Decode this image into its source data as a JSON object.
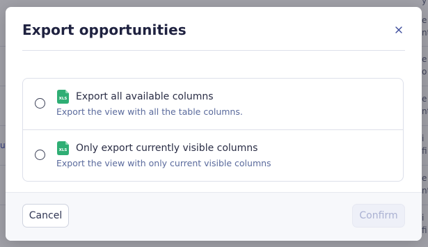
{
  "background": {
    "fragments": [
      {
        "text": "y",
        "accent": false
      },
      {
        "text": "e",
        "accent": false
      },
      {
        "text": "nt",
        "accent": false
      },
      {
        "text": "e",
        "accent": false
      },
      {
        "text": "o",
        "accent": false
      },
      {
        "text": "e",
        "accent": false
      },
      {
        "text": "nt",
        "accent": false
      },
      {
        "text": "ut",
        "accent": true
      },
      {
        "text": "i",
        "accent": false
      },
      {
        "text": "fi",
        "accent": false
      },
      {
        "text": "e",
        "accent": false
      },
      {
        "text": "nt",
        "accent": false
      },
      {
        "text": "i",
        "accent": false
      },
      {
        "text": "fi",
        "accent": false
      }
    ]
  },
  "modal": {
    "title": "Export opportunities",
    "close_icon": "close-icon",
    "options": [
      {
        "icon": "xls-file-icon",
        "icon_label": "XLS",
        "title": "Export all available columns",
        "description": "Export the view with all the table columns.",
        "selected": false
      },
      {
        "icon": "xls-file-icon",
        "icon_label": "XLS",
        "title": "Only export currently visible columns",
        "description": "Export the view with only current visible columns",
        "selected": false
      }
    ],
    "footer": {
      "cancel_label": "Cancel",
      "confirm_label": "Confirm",
      "confirm_disabled": true
    }
  },
  "colors": {
    "accent": "#3f4db8",
    "title": "#1f2240",
    "icon_green": "#2fae74",
    "confirm_disabled_text": "#aab1d2"
  }
}
